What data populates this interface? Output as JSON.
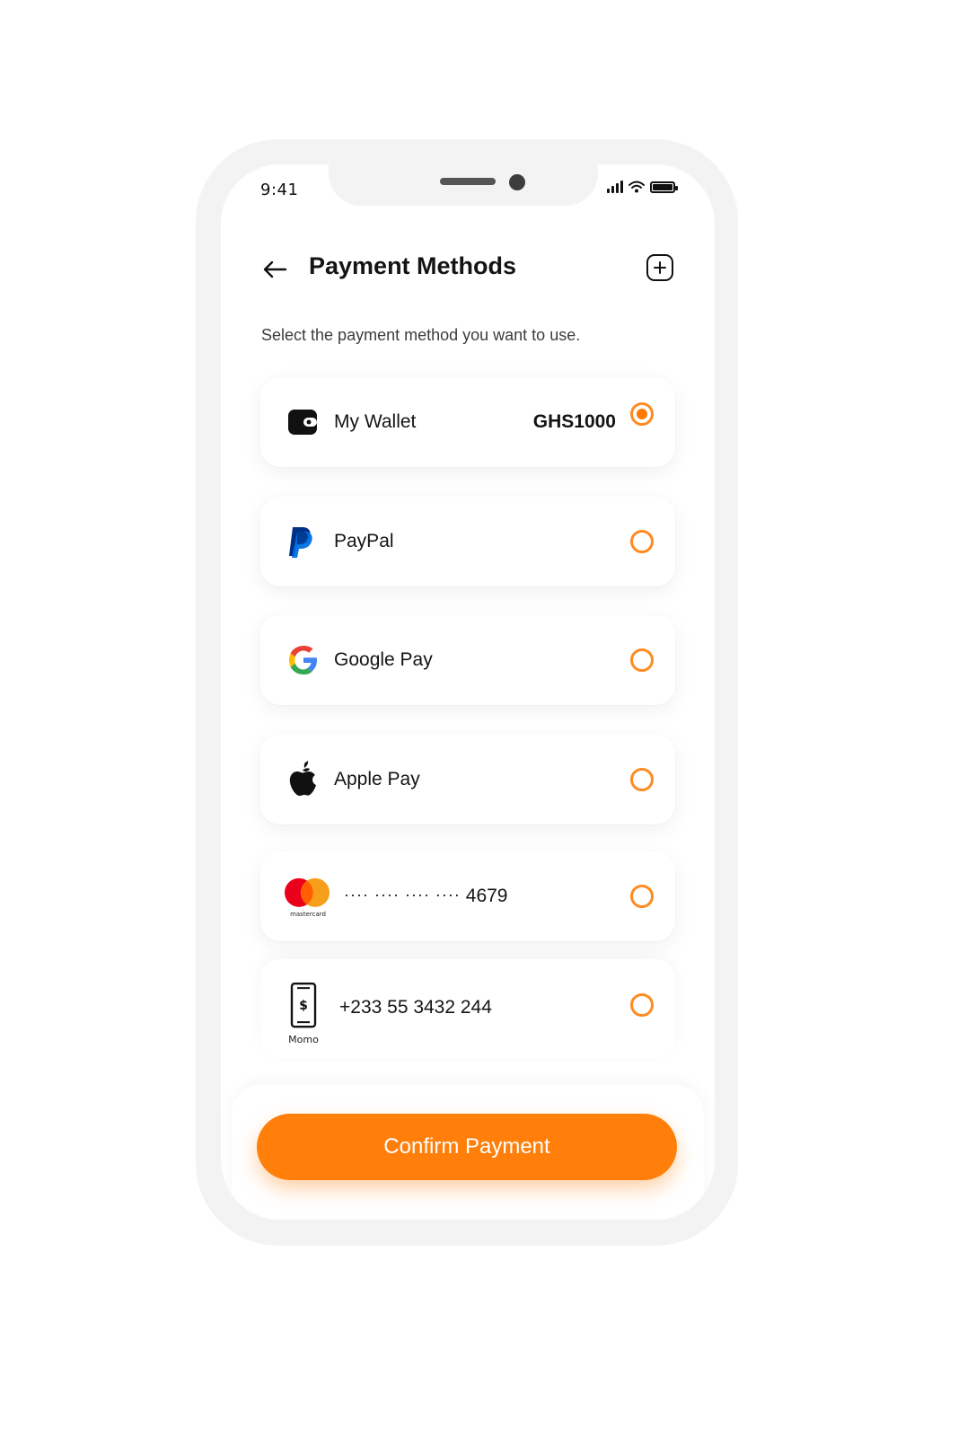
{
  "status_bar": {
    "time": "9:41"
  },
  "header": {
    "title": "Payment Methods",
    "subtitle": "Select the payment method you want to use."
  },
  "methods": [
    {
      "label": "My Wallet",
      "amount": "GHS1000",
      "icon": "wallet-icon",
      "selected": true
    },
    {
      "label": "PayPal",
      "icon": "paypal-icon",
      "selected": false
    },
    {
      "label": "Google Pay",
      "icon": "google-icon",
      "selected": false
    },
    {
      "label": "Apple Pay",
      "icon": "apple-icon",
      "selected": false
    },
    {
      "label_masked": "···· ···· ···· ····",
      "label_last4": "4679",
      "icon": "mastercard-icon",
      "icon_caption": "mastercard",
      "selected": false
    },
    {
      "label": "+233 55 3432 244",
      "icon": "momo-phone-icon",
      "icon_caption": "Momo",
      "selected": false
    }
  ],
  "confirm_button": {
    "label": "Confirm Payment"
  },
  "colors": {
    "accent": "#ff7f0a",
    "text": "#141414",
    "frame": "#f3f3f3"
  }
}
